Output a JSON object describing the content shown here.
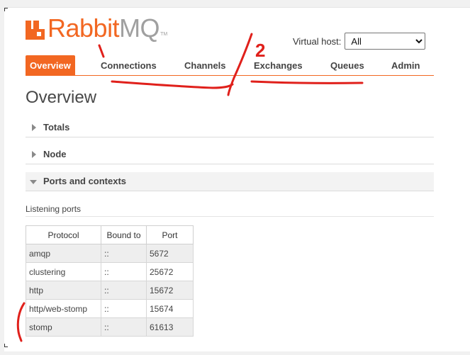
{
  "logo": {
    "rabbit": "Rabbit",
    "mq": "MQ",
    "tm": "TM"
  },
  "vhost": {
    "label": "Virtual host:",
    "selected": "All"
  },
  "tabs": [
    {
      "label": "Overview"
    },
    {
      "label": "Connections"
    },
    {
      "label": "Channels"
    },
    {
      "label": "Exchanges"
    },
    {
      "label": "Queues"
    },
    {
      "label": "Admin"
    }
  ],
  "page_title": "Overview",
  "sections": [
    {
      "label": "Totals"
    },
    {
      "label": "Node"
    },
    {
      "label": "Ports and contexts"
    }
  ],
  "listening_ports": {
    "title": "Listening ports",
    "headers": [
      "Protocol",
      "Bound to",
      "Port"
    ],
    "rows": [
      [
        "amqp",
        "::",
        "5672"
      ],
      [
        "clustering",
        "::",
        "25672"
      ],
      [
        "http",
        "::",
        "15672"
      ],
      [
        "http/web-stomp",
        "::",
        "15674"
      ],
      [
        "stomp",
        "::",
        "61613"
      ]
    ]
  },
  "annotations": {
    "number": "2"
  },
  "colors": {
    "brand": "#f26722",
    "ink": "#e0201b"
  }
}
